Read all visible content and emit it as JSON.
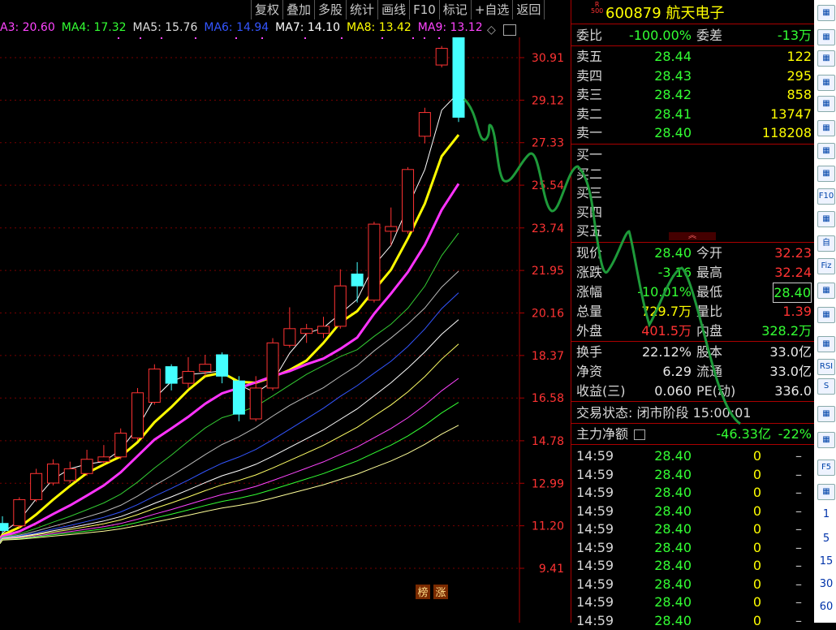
{
  "toolbar": [
    "复权",
    "叠加",
    "多股",
    "统计",
    "画线",
    "F10",
    "标记",
    "+自选",
    "返回"
  ],
  "ma_legend": [
    {
      "label": "A3: 20.60",
      "color": "#ff44ff"
    },
    {
      "label": "MA4: 17.32",
      "color": "#33ff33"
    },
    {
      "label": "MA5: 15.76",
      "color": "#dddddd"
    },
    {
      "label": "MA6: 14.94",
      "color": "#3355ff"
    },
    {
      "label": "MA7: 14.10",
      "color": "#ffffff"
    },
    {
      "label": "MA8: 13.42",
      "color": "#ffff00"
    },
    {
      "label": "MA9: 13.12",
      "color": "#ff44ff"
    }
  ],
  "chart_data": {
    "type": "candlestick",
    "price_high_label": "32.24",
    "price_axis": [
      "30.91",
      "29.12",
      "27.33",
      "25.54",
      "23.74",
      "21.95",
      "20.16",
      "18.37",
      "16.58",
      "14.78",
      "12.99",
      "11.20",
      "9.41"
    ],
    "ylim": [
      9.41,
      30.91
    ],
    "candles": [
      {
        "o": 11.0,
        "c": 11.3,
        "h": 11.6,
        "l": 10.9,
        "up": false
      },
      {
        "o": 11.2,
        "c": 12.3,
        "h": 12.4,
        "l": 11.1,
        "up": true
      },
      {
        "o": 12.3,
        "c": 13.4,
        "h": 13.6,
        "l": 12.2,
        "up": true
      },
      {
        "o": 13.0,
        "c": 13.8,
        "h": 14.0,
        "l": 12.9,
        "up": true
      },
      {
        "o": 13.1,
        "c": 13.6,
        "h": 13.9,
        "l": 13.0,
        "up": true
      },
      {
        "o": 13.4,
        "c": 14.0,
        "h": 14.4,
        "l": 13.3,
        "up": true
      },
      {
        "o": 13.9,
        "c": 14.1,
        "h": 14.6,
        "l": 13.8,
        "up": true
      },
      {
        "o": 14.1,
        "c": 15.1,
        "h": 15.3,
        "l": 14.0,
        "up": true
      },
      {
        "o": 14.9,
        "c": 16.8,
        "h": 17.0,
        "l": 14.8,
        "up": true
      },
      {
        "o": 16.4,
        "c": 17.8,
        "h": 18.0,
        "l": 16.3,
        "up": true
      },
      {
        "o": 17.9,
        "c": 17.2,
        "h": 18.0,
        "l": 16.9,
        "up": false
      },
      {
        "o": 17.2,
        "c": 17.7,
        "h": 18.3,
        "l": 17.0,
        "up": true
      },
      {
        "o": 17.7,
        "c": 18.0,
        "h": 18.4,
        "l": 17.5,
        "up": true
      },
      {
        "o": 18.4,
        "c": 17.5,
        "h": 18.5,
        "l": 17.2,
        "up": false
      },
      {
        "o": 17.3,
        "c": 15.9,
        "h": 17.5,
        "l": 15.6,
        "up": false
      },
      {
        "o": 15.7,
        "c": 17.0,
        "h": 17.5,
        "l": 15.6,
        "up": true
      },
      {
        "o": 17.0,
        "c": 18.9,
        "h": 19.1,
        "l": 16.9,
        "up": true
      },
      {
        "o": 18.8,
        "c": 19.5,
        "h": 20.4,
        "l": 18.7,
        "up": true
      },
      {
        "o": 19.3,
        "c": 19.5,
        "h": 19.7,
        "l": 18.9,
        "up": true
      },
      {
        "o": 19.3,
        "c": 19.6,
        "h": 20.0,
        "l": 19.1,
        "up": true
      },
      {
        "o": 19.6,
        "c": 21.3,
        "h": 22.0,
        "l": 19.5,
        "up": true
      },
      {
        "o": 21.8,
        "c": 21.3,
        "h": 22.3,
        "l": 20.6,
        "up": false
      },
      {
        "o": 20.7,
        "c": 23.9,
        "h": 24.0,
        "l": 20.6,
        "up": true
      },
      {
        "o": 23.6,
        "c": 23.8,
        "h": 24.6,
        "l": 23.0,
        "up": true
      },
      {
        "o": 23.6,
        "c": 26.2,
        "h": 26.3,
        "l": 23.5,
        "up": true
      },
      {
        "o": 27.6,
        "c": 28.6,
        "h": 28.8,
        "l": 27.3,
        "up": true
      },
      {
        "o": 30.6,
        "c": 31.3,
        "h": 31.4,
        "l": 30.5,
        "up": true
      },
      {
        "o": 32.2,
        "c": 28.4,
        "h": 32.24,
        "l": 28.2,
        "up": false
      }
    ],
    "labels": [
      "榜",
      "涨"
    ]
  },
  "stock": {
    "badge_top": "R",
    "badge_bottom": "500",
    "code": "600879",
    "name": "航天电子"
  },
  "weibi": {
    "label": "委比",
    "value": "-100.00%",
    "label2": "委差",
    "value2": "-13万"
  },
  "sell": [
    {
      "label": "卖五",
      "price": "28.44",
      "vol": "122"
    },
    {
      "label": "卖四",
      "price": "28.43",
      "vol": "295"
    },
    {
      "label": "卖三",
      "price": "28.42",
      "vol": "858"
    },
    {
      "label": "卖二",
      "price": "28.41",
      "vol": "13747"
    },
    {
      "label": "卖一",
      "price": "28.40",
      "vol": "118208"
    }
  ],
  "buy": [
    "买一",
    "买二",
    "买三",
    "买四",
    "买五"
  ],
  "quote": [
    {
      "l1": "现价",
      "v1": "28.40",
      "c1": "green",
      "l2": "今开",
      "v2": "32.23",
      "c2": "red"
    },
    {
      "l1": "涨跌",
      "v1": "-3.16",
      "c1": "green",
      "l2": "最高",
      "v2": "32.24",
      "c2": "red"
    },
    {
      "l1": "涨幅",
      "v1": "-10.01%",
      "c1": "green",
      "l2": "最低",
      "v2": "28.40",
      "c2": "green"
    },
    {
      "l1": "总量",
      "v1": "729.7万",
      "c1": "yellow",
      "l2": "量比",
      "v2": "1.39",
      "c2": "red"
    },
    {
      "l1": "外盘",
      "v1": "401.5万",
      "c1": "red",
      "l2": "内盘",
      "v2": "328.2万",
      "c2": "green"
    }
  ],
  "finance": [
    {
      "l1": "换手",
      "v1": "22.12%",
      "l2": "股本",
      "v2": "33.0亿"
    },
    {
      "l1": "净资",
      "v1": "6.29",
      "l2": "流通",
      "v2": "33.0亿"
    },
    {
      "l1": "收益(三)",
      "v1": "0.060",
      "l2": "PE(动)",
      "v2": "336.0"
    }
  ],
  "status": {
    "label": "交易状态:",
    "value": "闭市阶段 15:00:01"
  },
  "mainforce": {
    "label": "主力净额",
    "value": "-46.33亿",
    "pct": "-22%"
  },
  "ticks": [
    {
      "t": "14:59",
      "p": "28.40",
      "v": "0",
      "d": "–"
    },
    {
      "t": "14:59",
      "p": "28.40",
      "v": "0",
      "d": "–"
    },
    {
      "t": "14:59",
      "p": "28.40",
      "v": "0",
      "d": "–"
    },
    {
      "t": "14:59",
      "p": "28.40",
      "v": "0",
      "d": "–"
    },
    {
      "t": "14:59",
      "p": "28.40",
      "v": "0",
      "d": "–"
    },
    {
      "t": "14:59",
      "p": "28.40",
      "v": "0",
      "d": "–"
    },
    {
      "t": "14:59",
      "p": "28.40",
      "v": "0",
      "d": "–"
    },
    {
      "t": "14:59",
      "p": "28.40",
      "v": "0",
      "d": "–"
    },
    {
      "t": "14:59",
      "p": "28.40",
      "v": "0",
      "d": "–"
    },
    {
      "t": "14:59",
      "p": "28.40",
      "v": "0",
      "d": "–"
    }
  ],
  "sidebar": {
    "buttons": [
      "F10",
      "F5",
      "RSI",
      "S",
      "自",
      "Fiz"
    ],
    "numbers": [
      "1",
      "5",
      "15",
      "30",
      "60"
    ]
  }
}
